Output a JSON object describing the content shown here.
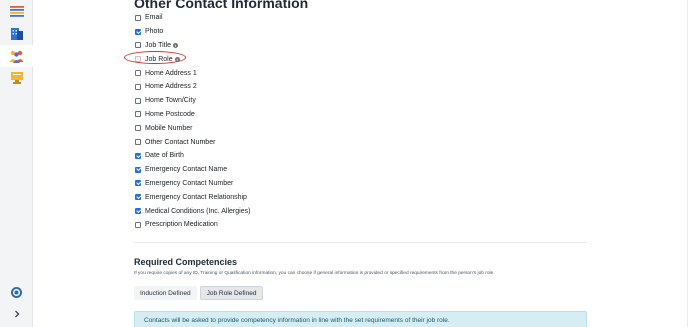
{
  "sidebar": {
    "icons": [
      {
        "name": "list-icon"
      },
      {
        "name": "building-icon"
      },
      {
        "name": "people-icon"
      },
      {
        "name": "presenter-icon"
      }
    ],
    "settings_icon": "gear-icon",
    "expand_icon": "chevron-right-icon"
  },
  "contact": {
    "title": "Other Contact Information",
    "fields": [
      {
        "label": "Email",
        "checked": false,
        "info": false
      },
      {
        "label": "Photo",
        "checked": true,
        "info": false
      },
      {
        "label": "Job Title",
        "checked": false,
        "info": true
      },
      {
        "label": "Job Role",
        "checked": false,
        "info": true
      },
      {
        "label": "Home Address 1",
        "checked": false,
        "info": false
      },
      {
        "label": "Home Address 2",
        "checked": false,
        "info": false
      },
      {
        "label": "Home Town/City",
        "checked": false,
        "info": false
      },
      {
        "label": "Home Postcode",
        "checked": false,
        "info": false
      },
      {
        "label": "Mobile Number",
        "checked": false,
        "info": false
      },
      {
        "label": "Other Contact Number",
        "checked": false,
        "info": false
      },
      {
        "label": "Date of Birth",
        "checked": true,
        "info": false
      },
      {
        "label": "Emergency Contact Name",
        "checked": true,
        "info": false
      },
      {
        "label": "Emergency Contact Number",
        "checked": true,
        "info": false
      },
      {
        "label": "Emergency Contact Relationship",
        "checked": true,
        "info": false
      },
      {
        "label": "Medical Conditions (Inc. Allergies)",
        "checked": true,
        "info": false
      },
      {
        "label": "Prescription Medication",
        "checked": false,
        "info": false
      }
    ]
  },
  "competencies": {
    "title": "Required Competencies",
    "description": "If you require copies of any ID, Training or Qualification information, you can choose if general information is provided or specified requirements from the person's job role.",
    "tabs": [
      {
        "label": "Induction Defined",
        "active": false
      },
      {
        "label": "Job Role Defined",
        "active": true
      }
    ],
    "alert": "Contacts will be asked to provide competency information in line with the set requirements of their job role."
  },
  "colors": {
    "accent": "#1f6feb",
    "highlight_ring": "#d93025",
    "alert_bg": "#d6eef3"
  }
}
